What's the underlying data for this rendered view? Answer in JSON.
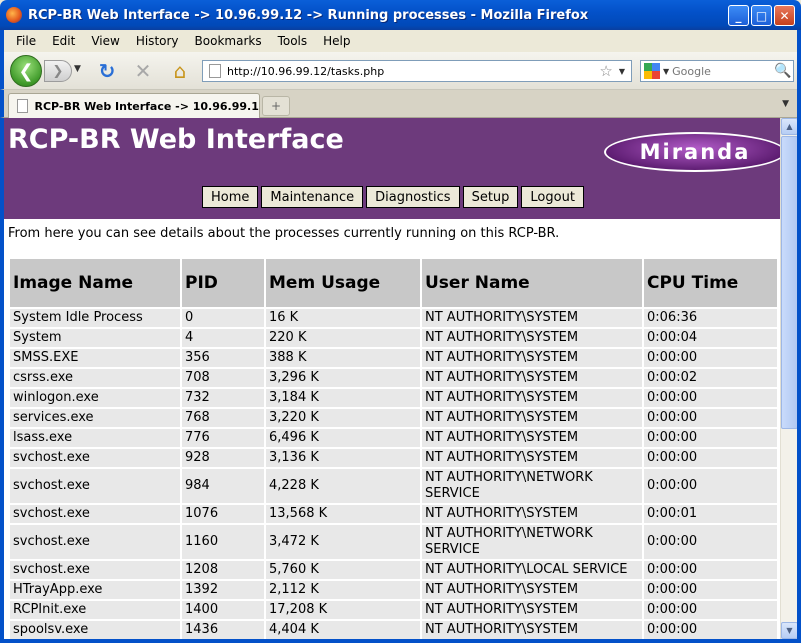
{
  "window": {
    "title": "RCP-BR Web Interface -> 10.96.99.12 -> Running processes - Mozilla Firefox",
    "minimize": "_",
    "maximize": "□",
    "close": "✕"
  },
  "menu": [
    "File",
    "Edit",
    "View",
    "History",
    "Bookmarks",
    "Tools",
    "Help"
  ],
  "toolbar": {
    "url": "http://10.96.99.12/tasks.php",
    "search_placeholder": "Google",
    "icons": {
      "back": "back-arrow-icon",
      "forward": "forward-arrow-icon",
      "reload": "reload-icon",
      "stop": "stop-icon",
      "home": "home-icon",
      "bookmark": "star-icon",
      "search": "magnifier-icon"
    }
  },
  "tabs": [
    {
      "title": "RCP-BR Web Interface -> 10.96.99.1..."
    }
  ],
  "page": {
    "site_title": "RCP-BR Web Interface",
    "logo_text": "Miranda",
    "nav": [
      "Home",
      "Maintenance",
      "Diagnostics",
      "Setup",
      "Logout"
    ],
    "intro": "From here you can see details about the processes currently running on this RCP-BR.",
    "header_color": "#6d3a7c",
    "table": {
      "columns": [
        "Image Name",
        "PID",
        "Mem Usage",
        "User Name",
        "CPU Time"
      ],
      "rows": [
        [
          "System Idle Process",
          "0",
          "16 K",
          "NT AUTHORITY\\SYSTEM",
          "0:06:36"
        ],
        [
          "System",
          "4",
          "220 K",
          "NT AUTHORITY\\SYSTEM",
          "0:00:04"
        ],
        [
          "SMSS.EXE",
          "356",
          "388 K",
          "NT AUTHORITY\\SYSTEM",
          "0:00:00"
        ],
        [
          "csrss.exe",
          "708",
          "3,296 K",
          "NT AUTHORITY\\SYSTEM",
          "0:00:02"
        ],
        [
          "winlogon.exe",
          "732",
          "3,184 K",
          "NT AUTHORITY\\SYSTEM",
          "0:00:00"
        ],
        [
          "services.exe",
          "768",
          "3,220 K",
          "NT AUTHORITY\\SYSTEM",
          "0:00:00"
        ],
        [
          "lsass.exe",
          "776",
          "6,496 K",
          "NT AUTHORITY\\SYSTEM",
          "0:00:00"
        ],
        [
          "svchost.exe",
          "928",
          "3,136 K",
          "NT AUTHORITY\\SYSTEM",
          "0:00:00"
        ],
        [
          "svchost.exe",
          "984",
          "4,228 K",
          "NT AUTHORITY\\NETWORK SERVICE",
          "0:00:00"
        ],
        [
          "svchost.exe",
          "1076",
          "13,568 K",
          "NT AUTHORITY\\SYSTEM",
          "0:00:01"
        ],
        [
          "svchost.exe",
          "1160",
          "3,472 K",
          "NT AUTHORITY\\NETWORK SERVICE",
          "0:00:00"
        ],
        [
          "svchost.exe",
          "1208",
          "5,760 K",
          "NT AUTHORITY\\LOCAL SERVICE",
          "0:00:00"
        ],
        [
          "HTrayApp.exe",
          "1392",
          "2,112 K",
          "NT AUTHORITY\\SYSTEM",
          "0:00:00"
        ],
        [
          "RCPInit.exe",
          "1400",
          "17,208 K",
          "NT AUTHORITY\\SYSTEM",
          "0:00:00"
        ],
        [
          "spoolsv.exe",
          "1436",
          "4,404 K",
          "NT AUTHORITY\\SYSTEM",
          "0:00:00"
        ]
      ]
    }
  }
}
